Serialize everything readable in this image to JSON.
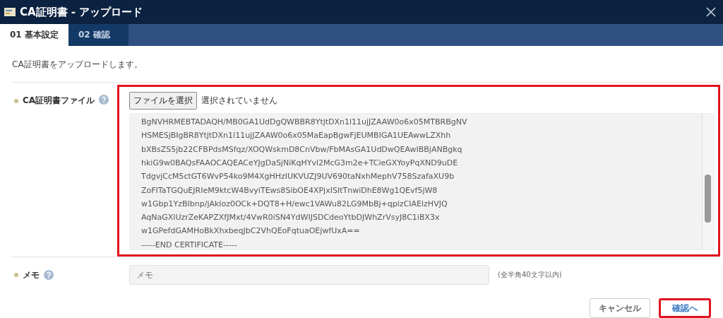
{
  "window": {
    "title": "CA証明書 - アップロード"
  },
  "tabs": [
    {
      "label": "01 基本設定",
      "selected": true
    },
    {
      "label": "02 確認",
      "selected": false
    }
  ],
  "description": "CA証明書をアップロードします。",
  "file_field": {
    "label": "CA証明書ファイル",
    "button": "ファイルを選択",
    "status": "選択されていません",
    "highlighted": true,
    "lines": [
      "BgNVHRMEBTADAQH/MB0GA1UdDgQWBBR8YtjtDXn1l11ujJZAAW0o6x05MTBRBgNV",
      "HSMESjBIgBR8YtjtDXn1l11ujJZAAW0o6x05MaEapBgwFjEUMBIGA1UEAwwLZXhh",
      "bXBsZS5jb22CFBPdsMSfqz/XOQWskmD8CnVbw/FbMAsGA1UdDwQEAwIBBjANBgkq",
      "hkiG9w0BAQsFAAOCAQEACeYJgDaSjNiKqHYvl2McG3m2e+TCieGXYoyPqXND9uDE",
      "TdgvjCcM5ctGT6WvP54ko9M4XgHHzIUKVUZJ9UV690taNxhMephV758SzafaXU9b",
      "ZoFITaTGQuEJRIeM9ktcW4BvyiTEws8SibOE4XPjxISItTnwiDhE8Wg1QEvf5jW8",
      "w1Gbp1YzBIbnp/jAkloz0OCk+DQT8+H/ewc1VAWu82LG9MbBj+qpizCIAElzHVJQ",
      "AqNaGXlUzrZeKAPZXfJMxt/4VwR0iSN4YdWIJSDCdeoYtbDJWhZrVsyJ8C1iBX3x",
      "w1GPefdGAMHoBkXhxbeqJbC2VhQEoFqtuaOEjwfUxA==",
      "-----END CERTIFICATE-----"
    ]
  },
  "memo_field": {
    "label": "メモ",
    "placeholder": "メモ",
    "hint": "(全半角40文字以内)"
  },
  "buttons": [
    {
      "label": "キャンセル",
      "kind": "secondary",
      "highlighted": false
    },
    {
      "label": "確認へ",
      "kind": "primary",
      "highlighted": true
    }
  ]
}
